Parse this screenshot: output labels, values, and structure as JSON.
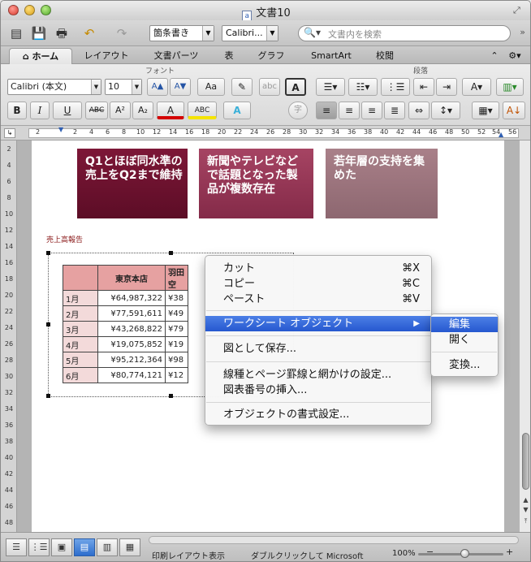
{
  "window": {
    "title": "文書10",
    "doc_icon_glyph": "a"
  },
  "toolbar": {
    "style_value": "箇条書き",
    "font_value": "Calibri...",
    "search_placeholder": "文書内を検索"
  },
  "ribbon_tabs": [
    "ホーム",
    "レイアウト",
    "文書パーツ",
    "表",
    "グラフ",
    "SmartArt",
    "校閲"
  ],
  "ribbon": {
    "font_group_label": "フォント",
    "paragraph_group_label": "段落",
    "font_name": "Calibri (本文)",
    "font_size": "10",
    "bold": "B",
    "italic": "I",
    "underline": "U",
    "strike": "ABC",
    "superscript": "A²",
    "subscript": "A₂",
    "font_color": "A",
    "highlight": "ABC",
    "effects": "A",
    "phonetic": "字",
    "grow": "A▲",
    "shrink": "A▼",
    "change_case": "Aa",
    "char_border": "A"
  },
  "ruler": {
    "h_labels": [
      "2",
      "2",
      "4",
      "6",
      "8",
      "10",
      "12",
      "14",
      "16",
      "18",
      "20",
      "22",
      "24",
      "26",
      "28",
      "30",
      "32",
      "34",
      "36",
      "38",
      "40",
      "42",
      "44",
      "46",
      "48",
      "50",
      "52",
      "54",
      "56"
    ],
    "v_labels": [
      "2",
      "4",
      "6",
      "8",
      "10",
      "12",
      "14",
      "16",
      "18",
      "20",
      "22",
      "24",
      "26",
      "28",
      "30",
      "32",
      "34",
      "36",
      "38",
      "40",
      "42",
      "44",
      "46",
      "48"
    ]
  },
  "smartart": [
    "Q1とほぼ同水準の売上をQ2まで維持",
    "新聞やテレビなどで話題となった製品が複数存在",
    "若年層の支持を集めた"
  ],
  "caption": "売上高報告",
  "sheet": {
    "headers": [
      "",
      "東京本店",
      "羽田空"
    ],
    "rows": [
      {
        "month": "1月",
        "value": "¥64,987,322",
        "cut": "¥38"
      },
      {
        "month": "2月",
        "value": "¥77,591,611",
        "cut": "¥49"
      },
      {
        "month": "3月",
        "value": "¥43,268,822",
        "cut": "¥79"
      },
      {
        "month": "4月",
        "value": "¥19,075,852",
        "cut": "¥19"
      },
      {
        "month": "5月",
        "value": "¥95,212,364",
        "cut": "¥98"
      },
      {
        "month": "6月",
        "value": "¥80,774,121",
        "cut": "¥12"
      }
    ]
  },
  "context_menu": {
    "items": [
      {
        "label": "カット",
        "shortcut": "⌘X"
      },
      {
        "label": "コピー",
        "shortcut": "⌘C"
      },
      {
        "label": "ペースト",
        "shortcut": "⌘V"
      },
      {
        "label": "ワークシート オブジェクト",
        "submenu_arrow": "▶"
      },
      {
        "label": "図として保存..."
      },
      {
        "label": "線種とページ罫線と網かけの設定..."
      },
      {
        "label": "図表番号の挿入..."
      },
      {
        "label": "オブジェクトの書式設定..."
      }
    ]
  },
  "submenu": {
    "items": [
      "編集",
      "開く",
      "変換..."
    ]
  },
  "status": {
    "view_name": "印刷レイアウト表示",
    "hint": "ダブルクリックして Microsoft",
    "zoom": "100%"
  },
  "colors": {
    "smartart1": "#6b1230",
    "smartart2": "#952f50",
    "smartart3": "#9a737c",
    "menu_highlight": "#3a6fde",
    "header_cell": "#e6a1a1"
  },
  "icons": {
    "toolbar": [
      "sidebar-icon",
      "save-icon",
      "print-icon",
      "undo-icon",
      "redo-icon",
      "search-icon"
    ],
    "tab_home": "house-icon"
  }
}
